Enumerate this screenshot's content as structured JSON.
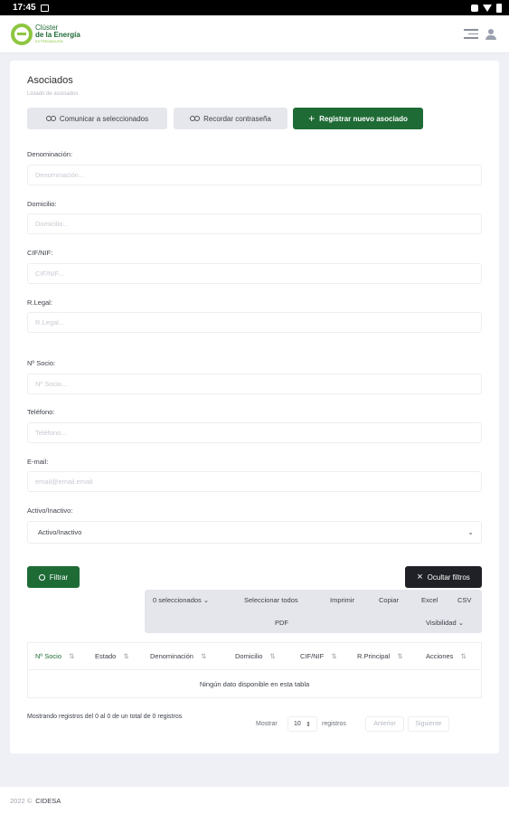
{
  "status_bar": {
    "time": "17:45"
  },
  "logo": {
    "line1": "Clúster",
    "line2": "de la Energía",
    "line3": "EXTREMADURA"
  },
  "page": {
    "title": "Asociados",
    "subtitle": "Listado de asociados"
  },
  "actions": {
    "communicate": "Comunicar a seleccionados",
    "remind_password": "Recordar contraseña",
    "register": "Registrar nuevo asociado"
  },
  "filters": {
    "denominacion": {
      "label": "Denominación:",
      "placeholder": "Denominación..."
    },
    "domicilio": {
      "label": "Domicilio:",
      "placeholder": "Domicilio..."
    },
    "cif": {
      "label": "CIF/NIF:",
      "placeholder": "CIF/NIF..."
    },
    "rlegal": {
      "label": "R.Legal:",
      "placeholder": "R.Legal..."
    },
    "socio": {
      "label": "Nº Socio:",
      "placeholder": "Nº Socio..."
    },
    "telefono": {
      "label": "Teléfono:",
      "placeholder": "Teléfono..."
    },
    "email": {
      "label": "E-mail:",
      "placeholder": "email@email.email"
    },
    "activo": {
      "label": "Activo/Inactivo:",
      "value": "Activo/Inactivo"
    },
    "filter_button": "Filtrar",
    "hide_button": "Ocultar filtros"
  },
  "toolbar": {
    "selected": "0 seleccionados",
    "select_all": "Seleccionar todos",
    "print": "Imprimir",
    "copy": "Copiar",
    "excel": "Excel",
    "csv": "CSV",
    "pdf": "PDF",
    "visibility": "Visibilidad"
  },
  "table": {
    "columns": [
      "Nº Socio",
      "Estado",
      "Denominación",
      "Domicilio",
      "CIF/NIF",
      "R.Principal",
      "Acciones"
    ],
    "empty": "Ningún dato disponible en esta tabla"
  },
  "pagination": {
    "info": "Mostrando registros del 0 al 0 de un total de 0 registros",
    "show": "Mostrar",
    "length": "10",
    "records": "registros",
    "prev": "Anterior",
    "next": "Siguiente"
  },
  "footer": {
    "year": "2022 ©",
    "brand": "CIDESA"
  },
  "colors": {
    "primary": "#1f6b36",
    "accent": "#8dc63f",
    "dark": "#1f2126"
  }
}
